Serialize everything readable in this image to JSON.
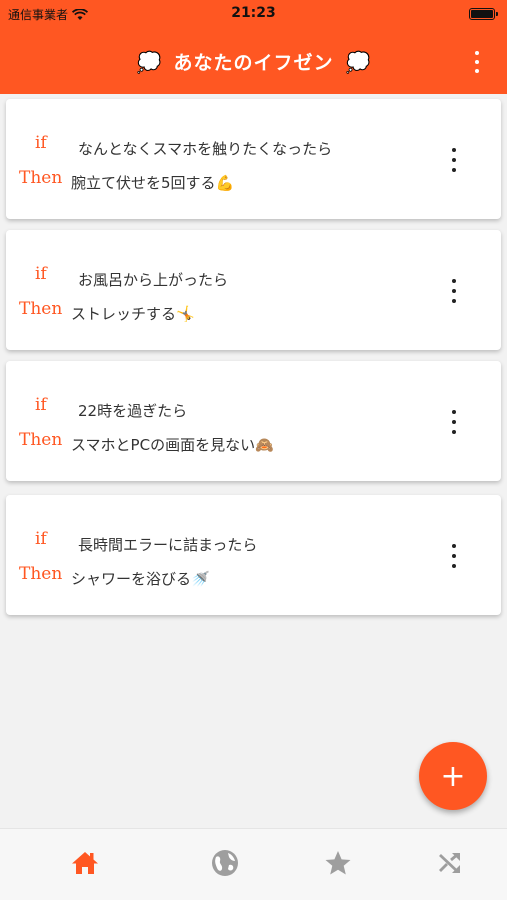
{
  "status_bar": {
    "carrier": "通信事業者",
    "time": "21:23"
  },
  "app_bar": {
    "title": "あなたのイフゼン",
    "title_icon": "thought-bubble",
    "menu_icon": "more-vert"
  },
  "rule_labels": {
    "if": "if",
    "then": "Then"
  },
  "rules": [
    {
      "if": "なんとなくスマホを触りたくなったら",
      "then": "腕立て伏せを5回する💪"
    },
    {
      "if": "お風呂から上がったら",
      "then": "ストレッチする🤸"
    },
    {
      "if": "22時を過ぎたら",
      "then": "スマホとPCの画面を見ない🙈"
    },
    {
      "if": "長時間エラーに詰まったら",
      "then": "シャワーを浴びる🚿"
    }
  ],
  "fab": {
    "label": "+",
    "icon": "add"
  },
  "bottom_nav": [
    {
      "icon": "home",
      "active": true
    },
    {
      "icon": "globe",
      "active": false
    },
    {
      "icon": "star",
      "active": false
    },
    {
      "icon": "shuffle",
      "active": false
    }
  ],
  "colors": {
    "accent": "#ff5722",
    "inactive_icon": "#9e9e9e"
  }
}
